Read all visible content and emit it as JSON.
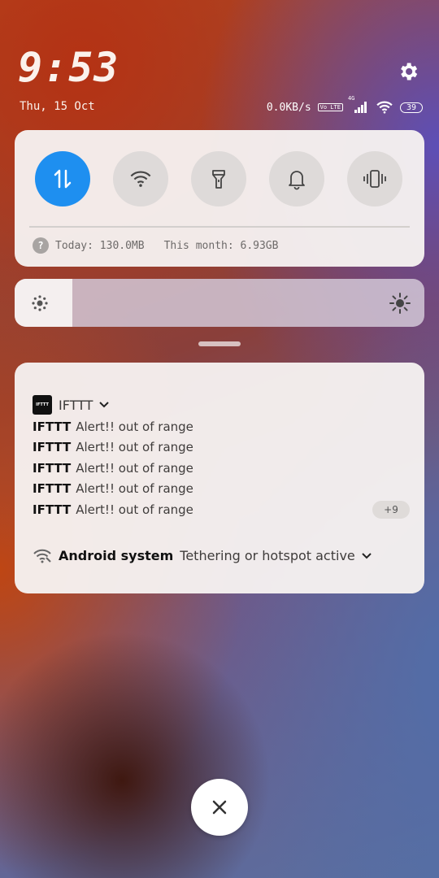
{
  "header": {
    "time": "9:53",
    "date": "Thu, 15 Oct",
    "network_speed": "0.0KB/s",
    "volte_label": "Vo LTE",
    "network_type": "4G",
    "battery": "39"
  },
  "quick_settings": {
    "toggles": [
      {
        "name": "mobile-data",
        "icon": "data-arrows-icon",
        "active": true
      },
      {
        "name": "wifi",
        "icon": "wifi-icon",
        "active": false
      },
      {
        "name": "flashlight",
        "icon": "flashlight-icon",
        "active": false
      },
      {
        "name": "sound",
        "icon": "bell-icon",
        "active": false
      },
      {
        "name": "vibrate",
        "icon": "vibrate-icon",
        "active": false
      }
    ],
    "usage_today": "Today: 130.0MB",
    "usage_month": "This month: 6.93GB"
  },
  "brightness": {
    "level": 0.14
  },
  "notifications": {
    "app_name": "IFTTT",
    "app_icon_label": "IFTTT",
    "messages": [
      {
        "title": "IFTTT",
        "text": "Alert!! out of range"
      },
      {
        "title": "IFTTT",
        "text": "Alert!! out of range"
      },
      {
        "title": "IFTTT",
        "text": "Alert!! out of range"
      },
      {
        "title": "IFTTT",
        "text": "Alert!! out of range"
      },
      {
        "title": "IFTTT",
        "text": "Alert!! out of range"
      }
    ],
    "more_count": "+9",
    "system": {
      "app": "Android system",
      "text": "Tethering or hotspot active"
    }
  },
  "colors": {
    "accent": "#1e8ff0"
  }
}
